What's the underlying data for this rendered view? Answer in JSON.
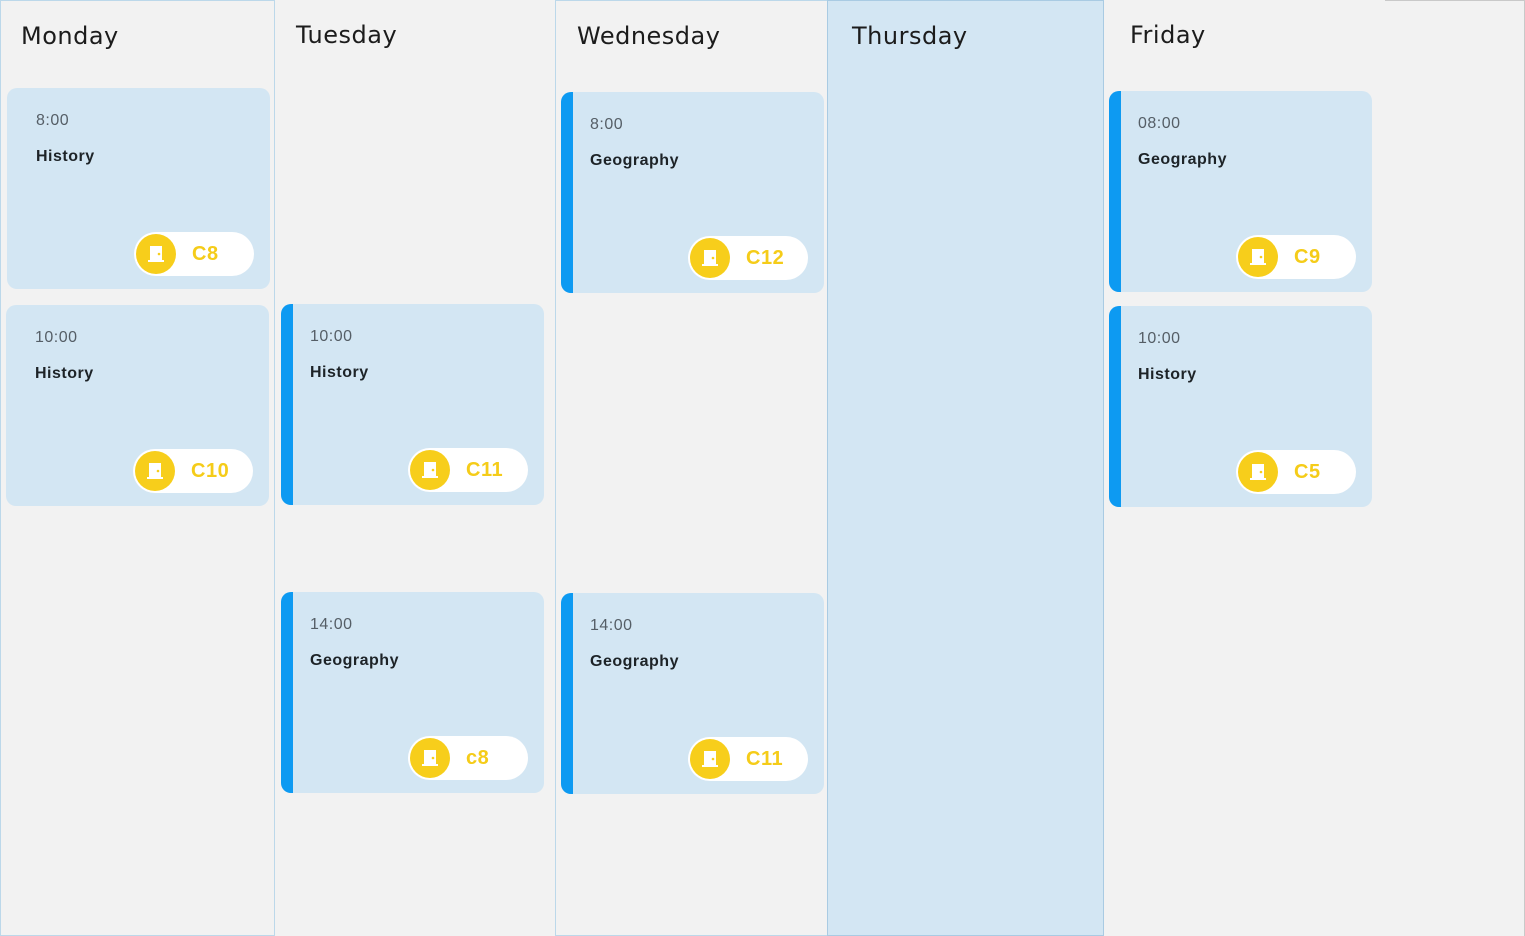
{
  "days": [
    {
      "title": "Monday",
      "lessons": [
        {
          "time": "8:00",
          "subject": "History",
          "room": "C8"
        },
        {
          "time": "10:00",
          "subject": "History",
          "room": "C10"
        }
      ]
    },
    {
      "title": "Tuesday",
      "lessons": [
        {
          "time": "10:00",
          "subject": "History",
          "room": "C11"
        },
        {
          "time": "14:00",
          "subject": "Geography",
          "room": "c8"
        }
      ]
    },
    {
      "title": "Wednesday",
      "lessons": [
        {
          "time": "8:00",
          "subject": "Geography",
          "room": "C12"
        },
        {
          "time": "14:00",
          "subject": "Geography",
          "room": "C11"
        }
      ]
    },
    {
      "title": "Thursday",
      "lessons": []
    },
    {
      "title": "Friday",
      "lessons": [
        {
          "time": "08:00",
          "subject": "Geography",
          "room": "C9"
        },
        {
          "time": "10:00",
          "subject": "History",
          "room": "C5"
        }
      ]
    }
  ],
  "colors": {
    "card_background": "#d3e6f3",
    "accent_bar": "#0d9af2",
    "room_badge": "#f7ce1b",
    "page_background": "#f2f2f2"
  },
  "icons": {
    "room": "door-icon"
  }
}
